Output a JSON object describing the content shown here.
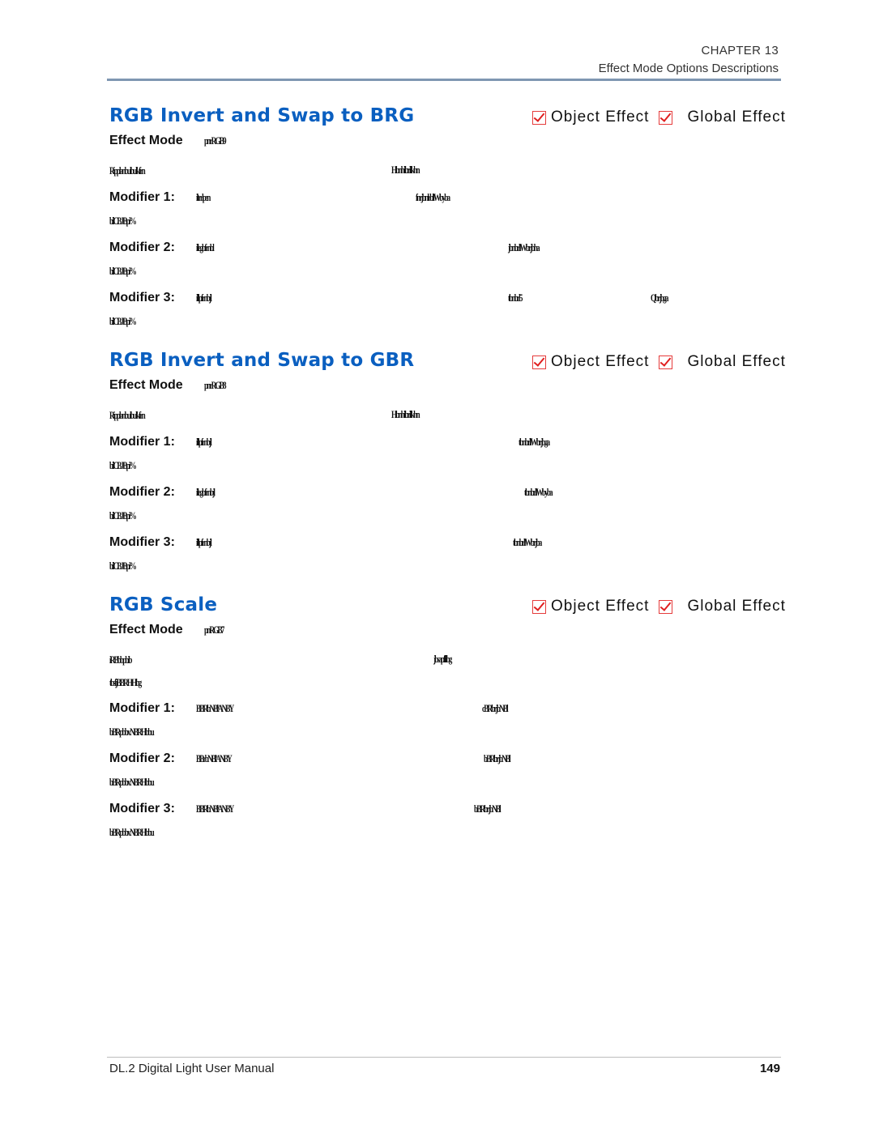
{
  "header": {
    "chapter": "CHAPTER 13",
    "subtitle": "Effect Mode Options Descriptions"
  },
  "effect_labels": {
    "object": "Object Effect",
    "global": "Global Effect",
    "checkbox_icon": "checked-box-icon"
  },
  "sections": [
    {
      "title": "RGB Invert and Swap to BRG",
      "object_effect_checked": true,
      "global_effect_checked": true,
      "effect_mode_label": "Effect Mode",
      "effect_mode_value": "pnrRGB9",
      "description": [
        "Ripplanbulbulkfrn",
        "Hbnhilbrillkhn"
      ],
      "modifiers": [
        {
          "label": "Modifier 1:",
          "text_a": "iltrrlpen",
          "text_b": "fnrjbnlrbllWbyba",
          "text_c": "bilCBJBpi%"
        },
        {
          "label": "Modifier 2:",
          "text_a": "illegbfrnbl",
          "text_b": "jbnbrllWbrjbha",
          "text_c": "bilCBJBpi%"
        },
        {
          "label": "Modifier 3:",
          "text_a": "illlpfrnbjl",
          "text_b": "tbnbrl5",
          "text_d": "Qbrjbga",
          "text_c": "bilCBJBpi%"
        }
      ]
    },
    {
      "title": "RGB Invert and Swap to GBR",
      "object_effect_checked": true,
      "global_effect_checked": true,
      "effect_mode_label": "Effect Mode",
      "effect_mode_value": "pnrRGB8",
      "description": [
        "Ripplanbulbulkfrn",
        "Hbnhilbrillkhn"
      ],
      "modifiers": [
        {
          "label": "Modifier 1:",
          "text_a": "illlpfrnbjl",
          "text_b": "tbnbrllWbrjbga",
          "text_c": "bilCBJBpi%"
        },
        {
          "label": "Modifier 2:",
          "text_a": "illegbfrnbjl",
          "text_b": "tbnbrllWbyba",
          "text_c": "bilCBJBpi%"
        },
        {
          "label": "Modifier 3:",
          "text_a": "illlpfrnbjl",
          "text_b": "tbnbrllWbrjba",
          "text_c": "bilCBJBpi%"
        }
      ]
    },
    {
      "title": "RGB Scale",
      "object_effect_checked": true,
      "global_effect_checked": true,
      "effect_mode_label": "Effect Mode",
      "effect_mode_value": "pnRGB7",
      "description": [
        "iRBbbpbib",
        "jbsapflilbg",
        "tbsfjBBRHHbg"
      ],
      "modifiers": [
        {
          "label": "Modifier 1:",
          "text_a": "BBRbNBl/ANBY",
          "text_b": "cBRbrjbNBl",
          "text_c": "bBRpbbx NBRHbbu"
        },
        {
          "label": "Modifier 2:",
          "text_a": "BBrbNBl/ANBY",
          "text_b": "bBRbrjbNBl",
          "text_c": "bBRpbbx NBRHbbu"
        },
        {
          "label": "Modifier 3:",
          "text_a": "BBRbNBl/ANBY",
          "text_b": "bBRbrjbNBl",
          "text_c": "bBRpbbx NBRHbbu"
        }
      ]
    }
  ],
  "footer": {
    "manual_title": "DL.2 Digital Light User Manual",
    "page_number": "149"
  }
}
